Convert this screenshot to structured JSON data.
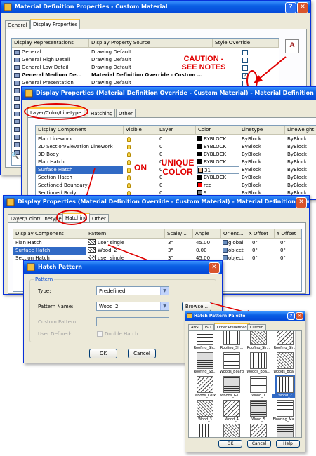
{
  "win1": {
    "title": "Material Definition Properties - Custom Material",
    "tabs": [
      "General",
      "Display Properties"
    ],
    "headers": [
      "Display Representations",
      "Display Property Source",
      "Style Override"
    ],
    "rows": [
      {
        "rep": "General",
        "source": "Drawing Default",
        "override": false
      },
      {
        "rep": "General High Detail",
        "source": "Drawing Default",
        "override": false
      },
      {
        "rep": "General Low Detail",
        "source": "Drawing Default",
        "override": false
      },
      {
        "rep": "General Medium De...",
        "source": "Material Definition Override - Custom ...",
        "override": true
      },
      {
        "rep": "General Presentation",
        "source": "Drawing Default",
        "override": false
      }
    ]
  },
  "annotations": {
    "caution": "CAUTION -\nSEE NOTES",
    "on": "ON",
    "unique_color": "UNIQUE\nCOLOR"
  },
  "win2": {
    "title": "Display Properties (Material Definition Override - Custom Material) - Material Definition",
    "tabs": [
      "Layer/Color/Linetype",
      "Hatching",
      "Other"
    ],
    "headers": [
      "Display Component",
      "Visible",
      "Layer",
      "Color",
      "Linetype",
      "Lineweight"
    ],
    "rows": [
      {
        "component": "Plan Linework",
        "layer": "0",
        "color": "BYBLOCK",
        "swatch": "#000000",
        "linetype": "ByBlock",
        "lineweight": "ByBlock"
      },
      {
        "component": "2D Section/Elevation Linework",
        "layer": "0",
        "color": "BYBLOCK",
        "swatch": "#000000",
        "linetype": "ByBlock",
        "lineweight": "ByBlock"
      },
      {
        "component": "3D Body",
        "layer": "0",
        "color": "BYBLOCK",
        "swatch": "#000000",
        "linetype": "ByBlock",
        "lineweight": "ByBlock"
      },
      {
        "component": "Plan Hatch",
        "layer": "0",
        "color": "BYBLOCK",
        "swatch": "#000000",
        "linetype": "ByBlock",
        "lineweight": "ByBlock"
      },
      {
        "component": "Surface Hatch",
        "layer": "0",
        "color": "31",
        "swatch": "#f2c29a",
        "linetype": "ByBlock",
        "lineweight": "ByBlock"
      },
      {
        "component": "Section Hatch",
        "layer": "0",
        "color": "BYBLOCK",
        "swatch": "#000000",
        "linetype": "ByBlock",
        "lineweight": "ByBlock"
      },
      {
        "component": "Sectioned Boundary",
        "layer": "0",
        "color": "red",
        "swatch": "#ff0000",
        "linetype": "ByBlock",
        "lineweight": "ByBlock"
      },
      {
        "component": "Sectioned Body",
        "layer": "0",
        "color": "9",
        "swatch": "#808080",
        "linetype": "ByBlock",
        "lineweight": "ByBlock"
      }
    ]
  },
  "win3": {
    "title": "Display Properties (Material Definition Override - Custom Material) - Material Definition Gener...",
    "tabs": [
      "Layer/Color/Linetype",
      "Hatching",
      "Other"
    ],
    "headers": [
      "Display Component",
      "Pattern",
      "Scale/...",
      "Angle",
      "Orient...",
      "X Offset",
      "Y Offset"
    ],
    "rows": [
      {
        "component": "Plan Hatch",
        "pattern": "user single",
        "scale": "3\"",
        "angle": "45.00",
        "orient": "global",
        "xoff": "0\"",
        "yoff": "0\""
      },
      {
        "component": "Surface Hatch",
        "pattern": "Wood_2",
        "scale": "3\"",
        "angle": "0.00",
        "orient": "object",
        "xoff": "0\"",
        "yoff": "0\""
      },
      {
        "component": "Section Hatch",
        "pattern": "user single",
        "scale": "3\"",
        "angle": "45.00",
        "orient": "object",
        "xoff": "0\"",
        "yoff": "0\""
      }
    ]
  },
  "win4": {
    "title": "Hatch Pattern",
    "group": "Pattern",
    "type_label": "Type:",
    "type_value": "Predefined",
    "name_label": "Pattern Name:",
    "name_value": "Wood_2",
    "browse": "Browse...",
    "custom_label": "Custom Pattern:",
    "user_label": "User Defined:",
    "double_label": "Double Hatch",
    "ok": "OK",
    "cancel": "Cancel"
  },
  "win5": {
    "title": "Hatch Pattern Palette",
    "tabs": [
      "ANSI",
      "ISO",
      "Other Predefined",
      "Custom"
    ],
    "tiles": [
      "Roofing_Sh...",
      "Roofing_Sh...",
      "Roofing_Sh...",
      "Roofing_Sh...",
      "Roofing_Sp...",
      "Woods_Board",
      "Woods_Boa...",
      "Woods_Boa...",
      "Woods_Cork",
      "Woods_Glu...",
      "Wood_1",
      "Wood_2",
      "Wood_3",
      "Wood_4",
      "Wood_5",
      "Flooring_Ma...",
      "",
      "",
      "",
      ""
    ],
    "ok": "OK",
    "cancel": "Cancel",
    "help": "Help"
  }
}
